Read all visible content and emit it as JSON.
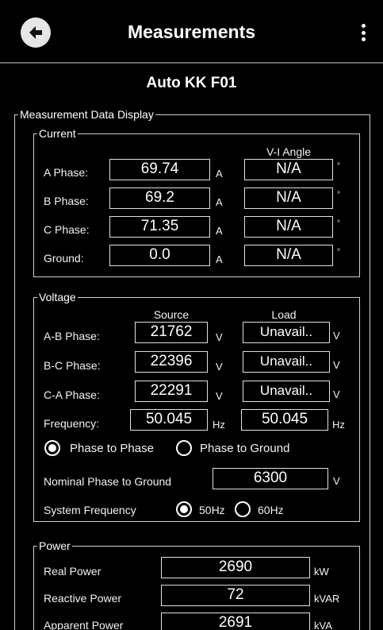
{
  "appbar": {
    "title": "Measurements",
    "back_icon": "arrow-left-icon",
    "menu_icon": "more-vert-icon"
  },
  "device_name": "Auto KK F01",
  "measurement_section": {
    "legend": "Measurement Data Display"
  },
  "current": {
    "legend": "Current",
    "vi_angle_header": "V-I Angle",
    "unit": "A",
    "deg_symbol": "°",
    "rows": [
      {
        "label": "A Phase:",
        "value": "69.74",
        "angle": "N/A"
      },
      {
        "label": "B Phase:",
        "value": "69.2",
        "angle": "N/A"
      },
      {
        "label": "C Phase:",
        "value": "71.35",
        "angle": "N/A"
      },
      {
        "label": "Ground:",
        "value": "0.0",
        "angle": "N/A"
      }
    ]
  },
  "voltage": {
    "legend": "Voltage",
    "source_header": "Source",
    "load_header": "Load",
    "unit": "V",
    "rows": [
      {
        "label": "A-B Phase:",
        "source": "21762",
        "load": "Unavail.."
      },
      {
        "label": "B-C Phase:",
        "source": "22396",
        "load": "Unavail.."
      },
      {
        "label": "C-A Phase:",
        "source": "22291",
        "load": "Unavail.."
      }
    ],
    "frequency": {
      "label": "Frequency:",
      "source": "50.045",
      "load": "50.045",
      "unit": "Hz"
    },
    "mode": {
      "options": [
        "Phase to Phase",
        "Phase to Ground"
      ],
      "selected": "Phase to Phase"
    },
    "nominal": {
      "label": "Nominal Phase to Ground",
      "value": "6300",
      "unit": "V"
    },
    "system_frequency": {
      "label": "System Frequency",
      "options": [
        "50Hz",
        "60Hz"
      ],
      "selected": "50Hz"
    }
  },
  "power": {
    "legend": "Power",
    "rows": [
      {
        "label": "Real Power",
        "value": "2690",
        "unit": "kW"
      },
      {
        "label": "Reactive Power",
        "value": "72",
        "unit": "kVAR"
      },
      {
        "label": "Apparent Power",
        "value": "2691",
        "unit": "kVA"
      }
    ]
  }
}
